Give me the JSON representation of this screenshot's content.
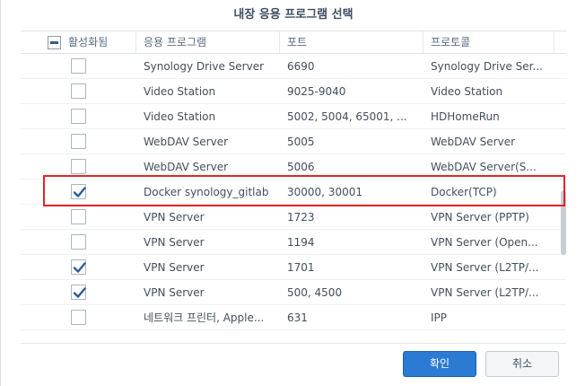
{
  "dialog": {
    "title": "내장 응용 프로그램 선택"
  },
  "columns": {
    "enabled": "활성화됨",
    "app": "응용 프로그램",
    "port": "포트",
    "protocol": "프로토콜"
  },
  "rows": [
    {
      "checked": false,
      "app": "Synology Drive Server",
      "port": "6690",
      "protocol": "Synology Drive Ser..."
    },
    {
      "checked": false,
      "app": "Video Station",
      "port": "9025-9040",
      "protocol": "Video Station"
    },
    {
      "checked": false,
      "app": "Video Station",
      "port": "5002, 5004, 65001, ...",
      "protocol": "HDHomeRun"
    },
    {
      "checked": false,
      "app": "WebDAV Server",
      "port": "5005",
      "protocol": "WebDAV Server"
    },
    {
      "checked": false,
      "app": "WebDAV Server",
      "port": "5006",
      "protocol": "WebDAV Server(S..."
    },
    {
      "checked": true,
      "app": "Docker synology_gitlab",
      "port": "30000, 30001",
      "protocol": "Docker(TCP)"
    },
    {
      "checked": false,
      "app": "VPN Server",
      "port": "1723",
      "protocol": "VPN Server (PPTP)"
    },
    {
      "checked": false,
      "app": "VPN Server",
      "port": "1194",
      "protocol": "VPN Server (Open..."
    },
    {
      "checked": true,
      "app": "VPN Server",
      "port": "1701",
      "protocol": "VPN Server (L2TP/..."
    },
    {
      "checked": true,
      "app": "VPN Server",
      "port": "500, 4500",
      "protocol": "VPN Server (L2TP/..."
    },
    {
      "checked": false,
      "app": "네트워크 프린터, Apple...",
      "port": "631",
      "protocol": "IPP"
    }
  ],
  "buttons": {
    "ok": "확인",
    "cancel": "취소"
  },
  "colors": {
    "accent": "#2b7ad3",
    "highlight": "#e0252a",
    "check": "#2d5d95"
  }
}
